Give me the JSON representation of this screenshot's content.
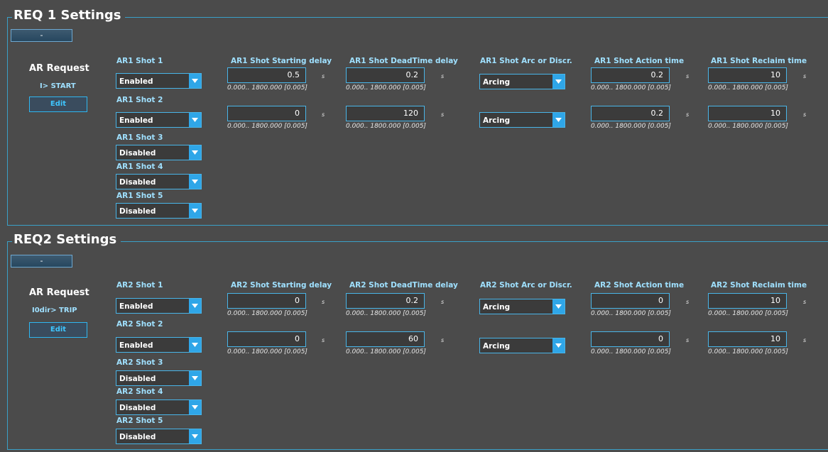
{
  "panels": [
    {
      "title": "REQ 1 Settings",
      "collapse_label": "-",
      "request_title": "AR Request",
      "request_value": "I> START",
      "edit_label": "Edit",
      "shot_labels": [
        "AR1 Shot 1",
        "AR1 Shot 2",
        "AR1 Shot 3",
        "AR1 Shot 4",
        "AR1 Shot 5"
      ],
      "shot_values": [
        "Enabled",
        "Enabled",
        "Disabled",
        "Disabled",
        "Disabled"
      ],
      "headers": {
        "start": "AR1 Shot Starting delay",
        "dead": "AR1 Shot DeadTime delay",
        "arc": "AR1 Shot Arc or Discr.",
        "action": "AR1 Shot Action time",
        "reclaim": "AR1 Shot Reclaim time"
      },
      "rows": [
        {
          "start": "0.5",
          "dead": "0.2",
          "arc": "Arcing",
          "action": "0.2",
          "reclaim": "10"
        },
        {
          "start": "0",
          "dead": "120",
          "arc": "Arcing",
          "action": "0.2",
          "reclaim": "10"
        }
      ]
    },
    {
      "title": "REQ2 Settings",
      "collapse_label": "-",
      "request_title": "AR Request",
      "request_value": "I0dir> TRIP",
      "edit_label": "Edit",
      "shot_labels": [
        "AR2 Shot 1",
        "AR2 Shot 2",
        "AR2 Shot 3",
        "AR2 Shot 4",
        "AR2 Shot 5"
      ],
      "shot_values": [
        "Enabled",
        "Enabled",
        "Disabled",
        "Disabled",
        "Disabled"
      ],
      "headers": {
        "start": "AR2 Shot Starting delay",
        "dead": "AR2 Shot DeadTime delay",
        "arc": "AR2 Shot Arc or Discr.",
        "action": "AR2 Shot Action time",
        "reclaim": "AR2 Shot Reclaim time"
      },
      "rows": [
        {
          "start": "0",
          "dead": "0.2",
          "arc": "Arcing",
          "action": "0",
          "reclaim": "10"
        },
        {
          "start": "0",
          "dead": "60",
          "arc": "Arcing",
          "action": "0",
          "reclaim": "10"
        }
      ]
    }
  ],
  "unit": "s",
  "range": "0.000.. 1800.000 [0.005]",
  "colors": {
    "accent": "#2fa6e8",
    "header_text": "#9fe0ff",
    "background": "#4b4b4b"
  }
}
